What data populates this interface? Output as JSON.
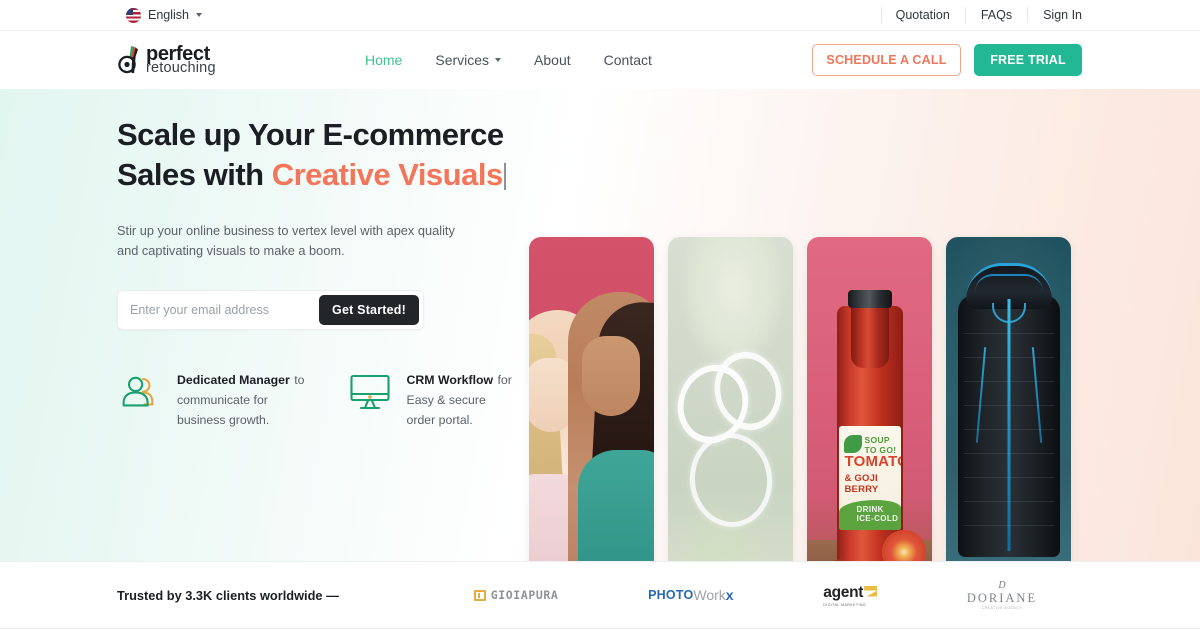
{
  "topbar": {
    "language": "English",
    "language_icon": "us-flag-icon",
    "caret_icon": "chevron-down-icon",
    "links": [
      "Quotation",
      "FAQs",
      "Sign In"
    ]
  },
  "nav": {
    "logo": {
      "line1": "perfect",
      "line2": "retouching",
      "icon": "perfect-retouching-logo-icon"
    },
    "menu": [
      {
        "label": "Home",
        "active": true
      },
      {
        "label": "Services",
        "active": false,
        "has_dropdown": true
      },
      {
        "label": "About",
        "active": false
      },
      {
        "label": "Contact",
        "active": false
      }
    ],
    "schedule_button": "SCHEDULE A CALL",
    "trial_button": "FREE TRIAL"
  },
  "hero": {
    "heading_line1": "Scale up Your E-commerce",
    "heading_line2_plain": "Sales with ",
    "heading_line2_accent": "Creative Visuals",
    "subtext": "Stir up your online business to vertex level with apex quality and captivating visuals to make a boom.",
    "email_placeholder": "Enter your email address",
    "email_value": "",
    "submit_label": "Get Started!",
    "features": [
      {
        "icon": "dedicated-manager-people-icon",
        "title": "Dedicated Manager",
        "desc": "to communicate for business growth."
      },
      {
        "icon": "crm-workflow-monitor-icon",
        "title": "CRM Workflow",
        "desc": "for Easy & secure order portal."
      }
    ],
    "cards": [
      {
        "name": "fashion-models-photo",
        "alt": "Two models in activewear on pink backdrop"
      },
      {
        "name": "diamond-ring-photo",
        "alt": "Diamond ring on sage green background"
      },
      {
        "name": "tomato-soup-bottle-photo",
        "alt": "Tomato and goji berry soup bottle"
      },
      {
        "name": "black-puffer-jacket-photo",
        "alt": "Black puffer jacket on teal background"
      }
    ]
  },
  "trusted": {
    "label": "Trusted by 3.3K clients worldwide —",
    "brands": [
      {
        "name": "gioiapura-logo",
        "text": "GIOIAPURA"
      },
      {
        "name": "photoworkx-logo",
        "part1": "PHOTO",
        "part2": "Work",
        "part3": "x"
      },
      {
        "name": "agent-logo",
        "text": "agent",
        "tagline": "DIGITAL MARKETING"
      },
      {
        "name": "doriane-logo",
        "mark": "D",
        "text": "DORIANE",
        "tagline": "CREATIVE AGENCY"
      }
    ]
  },
  "colors": {
    "accent_green": "#22b894",
    "accent_coral": "#f4765a",
    "nav_active": "#3fc08e",
    "dark_button": "#232629"
  }
}
